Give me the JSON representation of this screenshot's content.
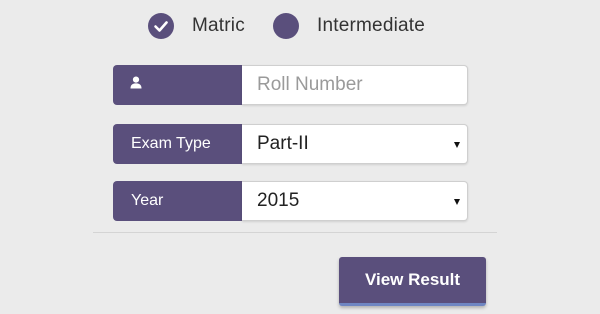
{
  "radios": [
    {
      "label": "Matric",
      "checked": true
    },
    {
      "label": "Intermediate",
      "checked": false
    }
  ],
  "form": {
    "roll": {
      "icon": "user-icon",
      "placeholder": "Roll Number",
      "value": ""
    },
    "exam_type": {
      "label": "Exam Type",
      "value": "Part-II"
    },
    "year": {
      "label": "Year",
      "value": "2015"
    }
  },
  "button": {
    "label": "View Result"
  },
  "colors": {
    "accent": "#5a4f7c",
    "button_underline": "#6f86c2",
    "background": "#ebebeb"
  }
}
